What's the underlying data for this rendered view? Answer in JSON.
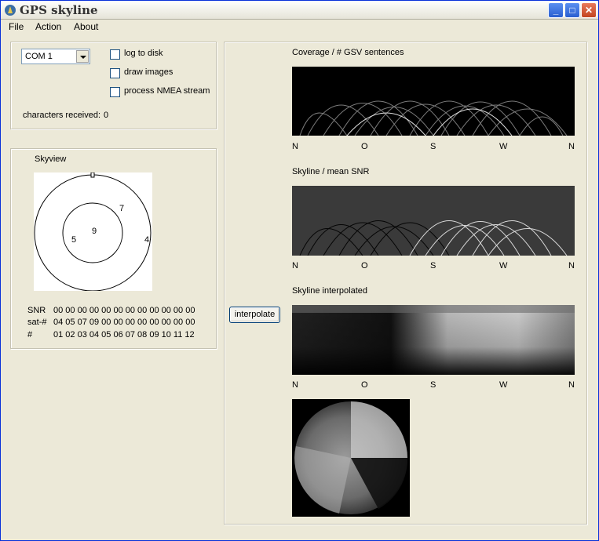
{
  "window": {
    "title": "GPS skyline"
  },
  "menu": {
    "items": [
      "File",
      "Action",
      "About"
    ]
  },
  "port": {
    "selected": "COM 1"
  },
  "options": {
    "log_to_disk": "log to disk",
    "draw_images": "draw images",
    "process_nmea": "process NMEA stream"
  },
  "stats": {
    "chars_label": "characters received:",
    "chars_value": "0"
  },
  "skyview": {
    "title": "Skyview",
    "sat_labels": [
      "7",
      "9",
      "5",
      "4"
    ]
  },
  "table": {
    "snr_label": "SNR",
    "snr_values": "00 00 00 00 00 00 00 00 00 00 00 00",
    "sat_label": "sat-#",
    "sat_values": "04 05 07 09 00 00 00 00 00 00 00 00",
    "idx_label": "#",
    "idx_values": "01 02 03 04 05 06 07 08 09 10 11 12"
  },
  "interpolate_button": "interpolate",
  "plots": {
    "coverage_title": "Coverage / # GSV sentences",
    "skyline_title": "Skyline / mean SNR",
    "interp_title": "Skyline interpolated"
  },
  "directions": [
    "N",
    "O",
    "S",
    "W",
    "N"
  ]
}
